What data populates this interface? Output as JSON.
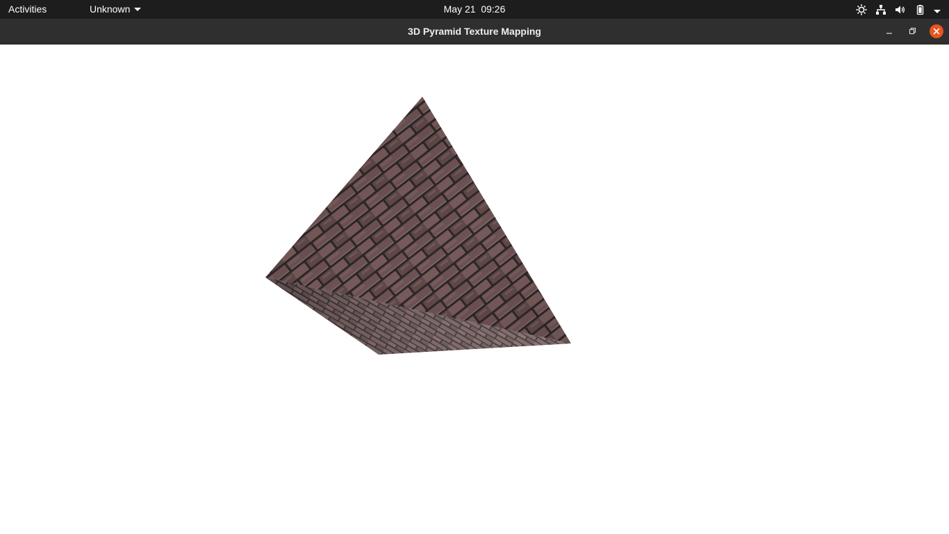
{
  "topbar": {
    "activities_label": "Activities",
    "app_menu_label": "Unknown",
    "clock": "May 21  09:26",
    "tray_icons": [
      "brightness-icon",
      "network-icon",
      "volume-icon",
      "battery-icon",
      "system-menu-chevron-icon"
    ]
  },
  "window": {
    "title": "3D Pyramid Texture Mapping",
    "buttons": [
      "minimize",
      "restore",
      "close"
    ],
    "close_color": "#e95420"
  },
  "scene": {
    "object": "pyramid",
    "texture": "brick",
    "background_color": "#ffffff",
    "brick_color": "#6e5252",
    "mortar_color": "#2a2424"
  }
}
